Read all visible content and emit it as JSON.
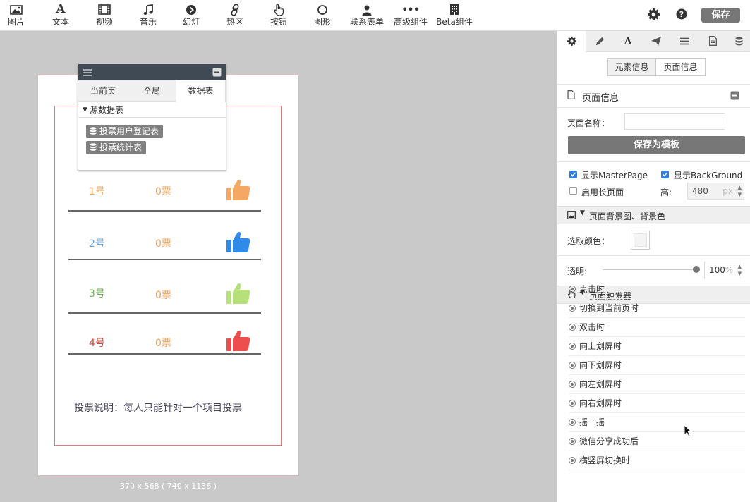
{
  "toolbar": {
    "items": [
      {
        "label": "图片",
        "icon": "image-icon"
      },
      {
        "label": "文本",
        "icon": "text-icon"
      },
      {
        "label": "视频",
        "icon": "video-icon"
      },
      {
        "label": "音乐",
        "icon": "music-icon"
      },
      {
        "label": "幻灯",
        "icon": "slideshow-icon"
      },
      {
        "label": "热区",
        "icon": "hotspot-link-icon"
      },
      {
        "label": "按钮",
        "icon": "pointer-hand-icon"
      },
      {
        "label": "图形",
        "icon": "circle-shape-icon"
      },
      {
        "label": "联系表单",
        "icon": "user-icon"
      },
      {
        "label": "高级组件",
        "icon": "more-dots-icon"
      },
      {
        "label": "Beta组件",
        "icon": "building-icon"
      }
    ],
    "save_label": "保存"
  },
  "data_panel": {
    "tabs": [
      "当前页",
      "全局",
      "数据表"
    ],
    "active_tab": "数据表",
    "section_title": "源数据表",
    "tables": [
      "投票用户登记表",
      "投票统计表"
    ]
  },
  "canvas": {
    "rows": [
      {
        "num": "1号",
        "count": "0票",
        "num_color": "#f0a35a",
        "thumb_color": "#f5a863"
      },
      {
        "num": "2号",
        "count": "0票",
        "num_color": "#6aa9e0",
        "thumb_color": "#2f8be8"
      },
      {
        "num": "3号",
        "count": "0票",
        "num_color": "#6cb04f",
        "thumb_color": "#b6e07a"
      },
      {
        "num": "4号",
        "count": "0票",
        "num_color": "#d9413a",
        "thumb_color": "#ef4e4e"
      }
    ],
    "description": "投票说明：每人只能针对一个项目投票",
    "size_label": "370 x 568 ( 740 x 1136 )"
  },
  "right_panel": {
    "segments": [
      "元素信息",
      "页面信息"
    ],
    "active_segment": "页面信息",
    "section_title": "页面信息",
    "page_name_label": "页面名称：",
    "page_name_value": "",
    "save_template_label": "保存为模板",
    "show_master_label": "显示MasterPage",
    "show_master_checked": true,
    "show_bg_label": "显示BackGround",
    "show_bg_checked": true,
    "long_page_label": "启用长页面",
    "long_page_checked": false,
    "height_label": "高:",
    "height_value": "480",
    "height_unit": "px",
    "bg_section_title": "页面背景图、背景色",
    "color_label": "选取颜色：",
    "opacity_label": "透明:",
    "opacity_value": "100",
    "opacity_unit": "%",
    "trigger_section_title": "页面触发器",
    "triggers": [
      "点击时",
      "切换到当前页时",
      "双击时",
      "向上划屏时",
      "向下划屏时",
      "向左划屏时",
      "向右划屏时",
      "摇一摇",
      "微信分享成功后",
      "横竖屏切换时"
    ]
  }
}
